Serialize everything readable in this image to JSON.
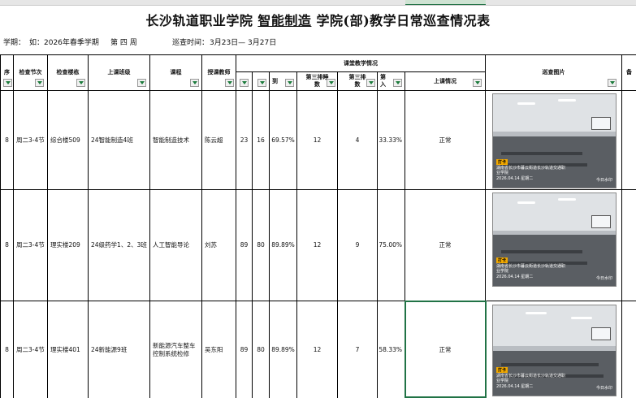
{
  "title": {
    "part1": "长沙轨道职业学院",
    "college": "智能制造",
    "part2": "学院(部)教学日常巡查情况表"
  },
  "meta": {
    "semester_label": "学期：",
    "semester_value": "如：2026年春季学期",
    "week_value": "第 四 周",
    "time_label": "巡查时间：",
    "time_value": "3月23日— 3月27日"
  },
  "headers": {
    "seq": "序",
    "period": "检查节次",
    "location": "检查楼栋",
    "class": "上课班级",
    "course": "课程",
    "teacher": "授课教师",
    "status_group": "课堂教学情况",
    "arrive": "到",
    "row3_sleep": "第三排睡",
    "row3_sleep_2": "数",
    "row3_listen": "第三排",
    "row3_listen_2": "数",
    "ratio": "第",
    "ratio_2": "入",
    "condition": "上课情况",
    "photo": "巡查图片",
    "remark": "备"
  },
  "rows": [
    {
      "seq": "8",
      "period": "周二3-4节",
      "location": "综合楼509",
      "class": "24智能制造4班",
      "course": "智能制造技术",
      "teacher": "陈云超",
      "enrolled": "23",
      "present": "16",
      "rate": "69.57%",
      "row3_a": "12",
      "row3_b": "4",
      "row3_rate": "33.33%",
      "condition": "正常"
    },
    {
      "seq": "8",
      "period": "周二3-4节",
      "location": "理实楼209",
      "class": "24级药学1、2、3班",
      "course": "人工智能导论",
      "teacher": "刘苏",
      "enrolled": "89",
      "present": "80",
      "rate": "89.89%",
      "row3_a": "12",
      "row3_b": "9",
      "row3_rate": "75.00%",
      "condition": "正常"
    },
    {
      "seq": "8",
      "period": "周二3-4节",
      "location": "理实楼401",
      "class": "24新能源9班",
      "course": "新能源汽车整车控制系统检修",
      "teacher": "吴东阳",
      "enrolled": "89",
      "present": "80",
      "rate": "89.89%",
      "row3_a": "12",
      "row3_b": "7",
      "row3_rate": "58.33%",
      "condition": "正常"
    }
  ],
  "photos": [
    {
      "badge": "打卡",
      "caption_1": "湖南省长沙市暮云街道长沙轨道交通职",
      "caption_2": "业学院",
      "date": "2026.04.14 星期二",
      "mark": "今日水印"
    },
    {
      "badge": "打卡",
      "caption_1": "湖南省长沙市暮云街道长沙轨道交通职",
      "caption_2": "业学院",
      "date": "2026.04.14 星期二",
      "mark": "今日水印"
    },
    {
      "badge": "打卡",
      "caption_1": "湖南省长沙市暮云街道长沙轨道交通职",
      "caption_2": "业学院",
      "date": "2026.04.14 星期二",
      "mark": "今日水印"
    }
  ],
  "colors": {
    "filter_arrow": "#1a7a3a",
    "selection": "#217346"
  }
}
